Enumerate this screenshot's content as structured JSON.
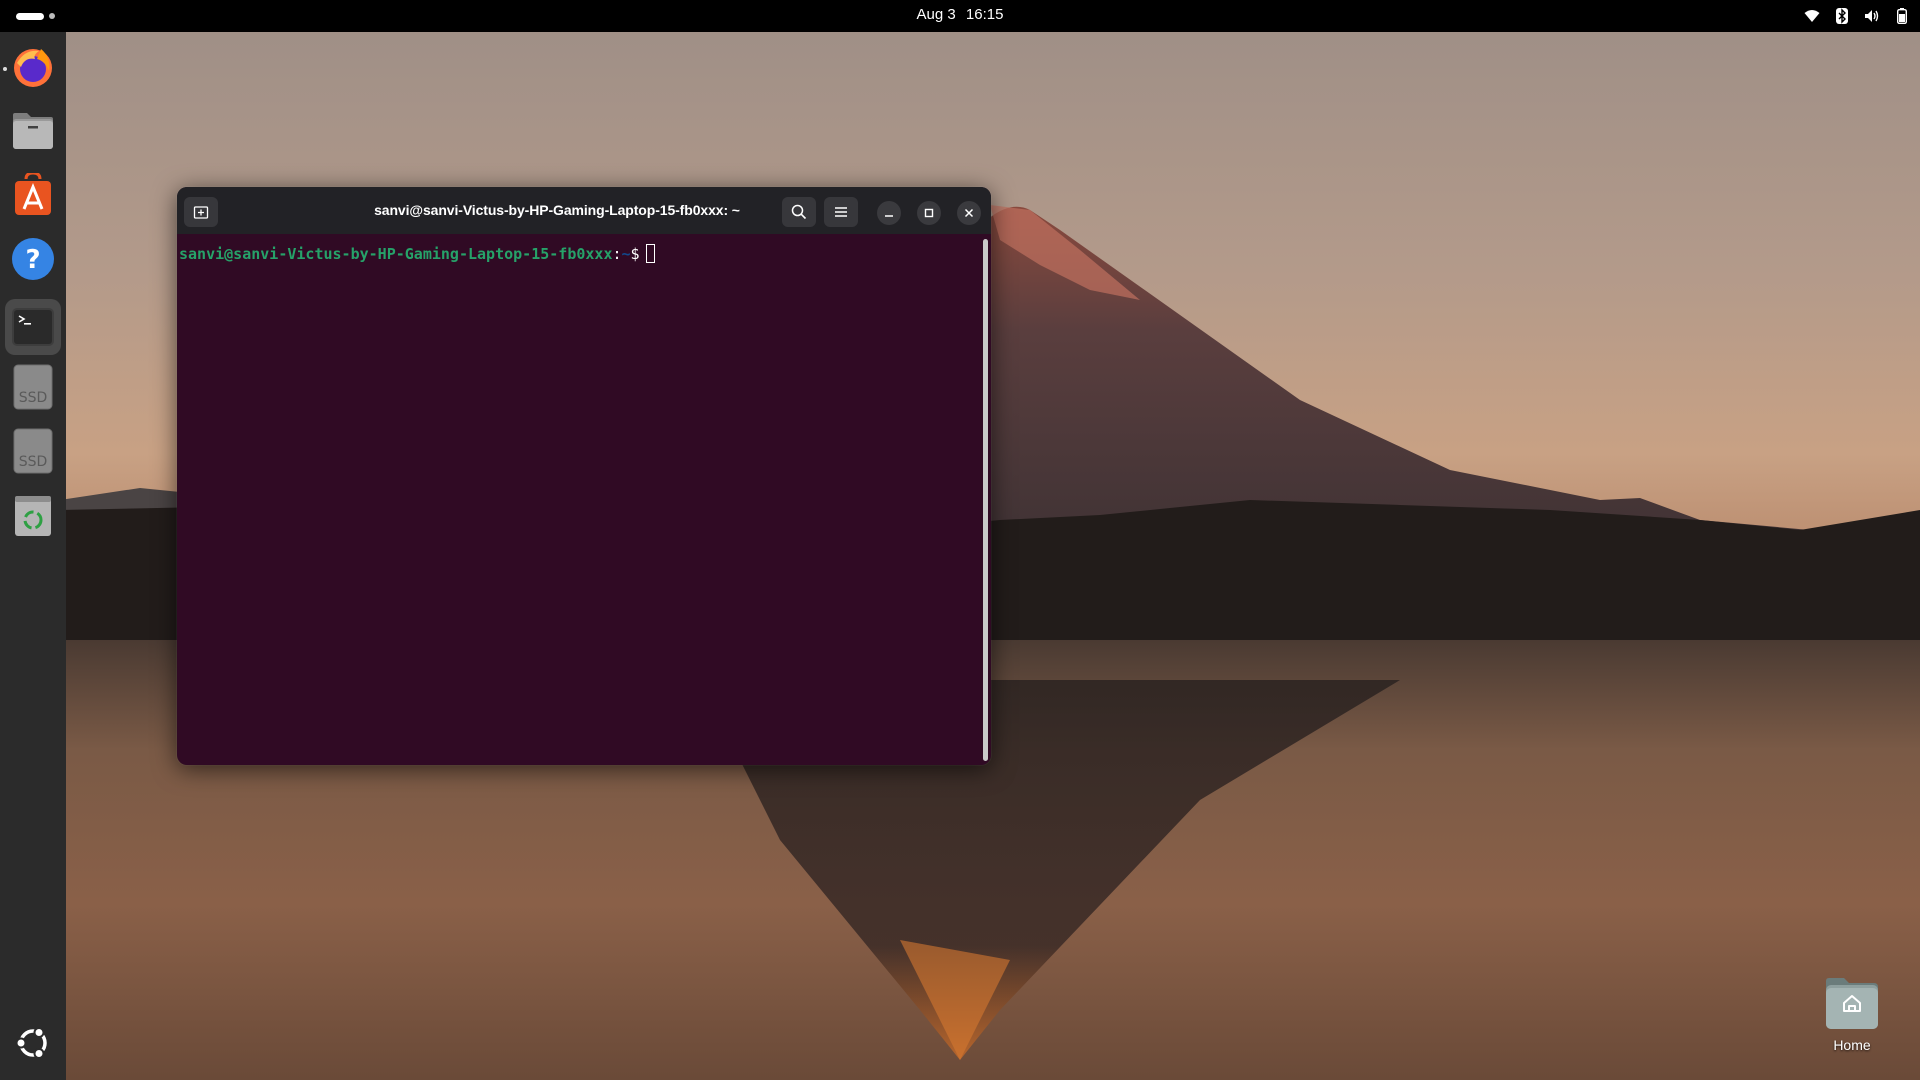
{
  "topbar": {
    "date": "Aug 3",
    "time": "16:15",
    "tray_icons": [
      "wifi-icon",
      "bluetooth-icon",
      "volume-icon",
      "battery-icon"
    ]
  },
  "dock": {
    "items": [
      {
        "name": "firefox",
        "icon": "firefox-icon",
        "running": true
      },
      {
        "name": "files",
        "icon": "files-icon"
      },
      {
        "name": "app-center",
        "icon": "app-center-icon"
      },
      {
        "name": "help",
        "icon": "help-icon"
      },
      {
        "name": "terminal",
        "icon": "terminal-icon",
        "active": true
      },
      {
        "name": "ssd-drive-1",
        "icon": "ssd-icon",
        "label": "SSD"
      },
      {
        "name": "ssd-drive-2",
        "icon": "ssd-icon",
        "label": "SSD"
      },
      {
        "name": "trash",
        "icon": "trash-icon"
      }
    ],
    "show_apps_icon": "ubuntu-logo-icon"
  },
  "terminal": {
    "title": "sanvi@sanvi-Victus-by-HP-Gaming-Laptop-15-fb0xxx: ~",
    "prompt_user": "sanvi@sanvi-Victus-by-HP-Gaming-Laptop-15-fb0xxx",
    "prompt_sep": ":",
    "prompt_path": "~",
    "prompt_symbol": "$",
    "colors": {
      "background": "#300a24",
      "user": "#26a269",
      "path": "#12488b",
      "header": "#222226"
    }
  },
  "desktop": {
    "home_label": "Home"
  }
}
